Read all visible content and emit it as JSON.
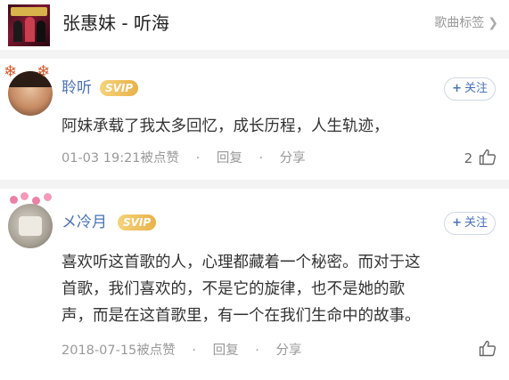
{
  "header": {
    "title": "张惠妹 - 听海",
    "tag_link": "歌曲标签",
    "chevron_icon": "chevron-right-icon"
  },
  "comments": [
    {
      "username": "聆听",
      "badge": "SVIP",
      "follow_label": "关注",
      "text": "阿妹承载了我太多回忆，成长历程，人生轨迹，",
      "date": "01-03 19:21",
      "like_action": "被点赞",
      "reply_action": "回复",
      "share_action": "分享",
      "like_count": "2",
      "separator": "·"
    },
    {
      "username": "メ冷月",
      "badge": "SVIP",
      "follow_label": "关注",
      "text_lines": [
        "喜欢听这首歌的人，心理都藏着一个秘密。而对于这",
        "首歌，我们喜欢的，不是它的旋律，也不是她的歌",
        "声，而是在这首歌里，有一个在我们生命中的故事。"
      ],
      "date": "2018-07-15",
      "like_action": "被点赞",
      "reply_action": "回复",
      "share_action": "分享",
      "separator": "·"
    }
  ],
  "colors": {
    "username": "#4a72b8",
    "svip_gold": "#e9b24b",
    "meta_gray": "#999999",
    "divider": "#f3f3f3"
  }
}
